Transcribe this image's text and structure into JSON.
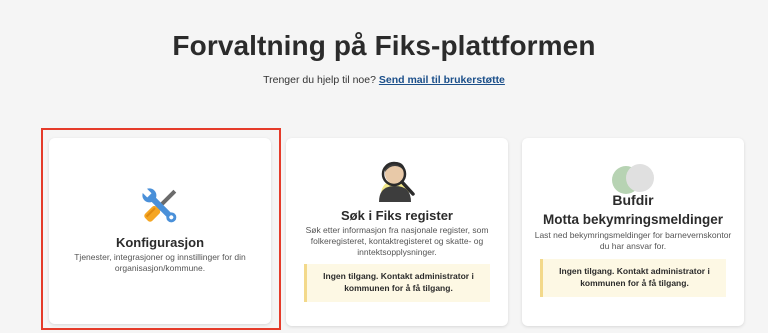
{
  "page": {
    "title": "Forvaltning på Fiks-plattformen",
    "help_text": "Trenger du hjelp til noe?",
    "help_link": "Send mail til brukerstøtte"
  },
  "cards": [
    {
      "icon": "tools-icon",
      "title": "Konfigurasjon",
      "description": "Tjenester, integrasjoner og innstillinger for din organisasjon/kommune."
    },
    {
      "icon": "person-search-icon",
      "title": "Søk i Fiks register",
      "description": "Søk etter informasjon fra nasjonale register, som folkeregisteret, kontaktregisteret og skatte- og inntektsopplysninger.",
      "notice": "Ingen tilgang. Kontakt administrator i kommunen for å få tilgang."
    },
    {
      "icon": "bufdir-logo-icon",
      "org": "Bufdir",
      "title": "Motta bekymringsmeldinger",
      "description": "Last ned bekymringsmeldinger for barnevernskontor du har ansvar for.",
      "notice": "Ingen tilgang. Kontakt administrator i kommunen for å få tilgang."
    }
  ],
  "colors": {
    "background": "#f5f5f5",
    "link": "#1b4f8a",
    "highlight": "#e53b2a",
    "notice_bg": "#fdf8e4"
  }
}
